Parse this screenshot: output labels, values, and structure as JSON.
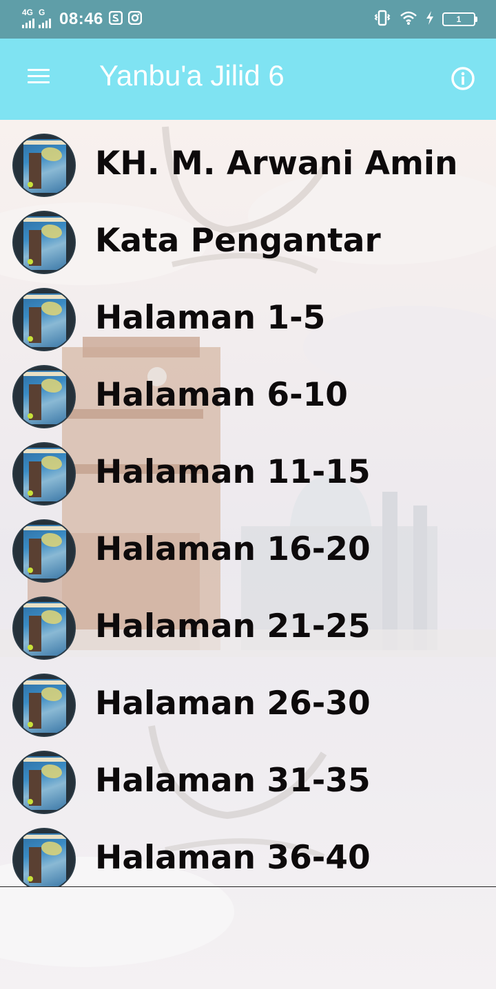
{
  "status_bar": {
    "net1": "4G",
    "net2": "G",
    "time": "08:46",
    "battery": "1"
  },
  "app_bar": {
    "title": "Yanbu'a Jilid 6"
  },
  "list": {
    "items": [
      {
        "label": "KH. M. Arwani Amin"
      },
      {
        "label": "Kata Pengantar"
      },
      {
        "label": "Halaman 1-5"
      },
      {
        "label": "Halaman 6-10"
      },
      {
        "label": "Halaman 11-15"
      },
      {
        "label": "Halaman 16-20"
      },
      {
        "label": "Halaman 21-25"
      },
      {
        "label": "Halaman 26-30"
      },
      {
        "label": "Halaman 31-35"
      },
      {
        "label": "Halaman 36-40"
      }
    ]
  },
  "colors": {
    "status_bar": "#5f9ea8",
    "app_bar": "#7fe3f2",
    "text": "#0d0a0b"
  }
}
